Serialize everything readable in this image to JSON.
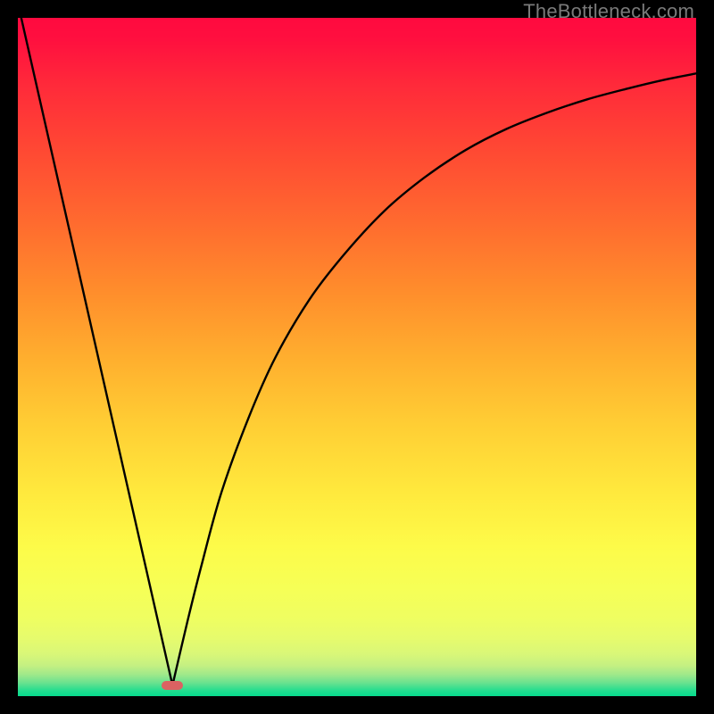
{
  "watermark": "TheBottleneck.com",
  "chart_data": {
    "type": "line",
    "title": "",
    "xlabel": "",
    "ylabel": "",
    "xlim": [
      0,
      100
    ],
    "ylim": [
      0,
      100
    ],
    "grid": false,
    "curve": {
      "comment": "V-shaped bottleneck curve; x in 0..100 across plot width, y is % height from bottom (0=bottom, 100=top)",
      "left_segment": [
        {
          "x": 0.5,
          "y": 100
        },
        {
          "x": 22.8,
          "y": 1.6
        }
      ],
      "right_segment_x": [
        22.8,
        25,
        27,
        30,
        34,
        38,
        43,
        48,
        54,
        60,
        66,
        72,
        78,
        84,
        90,
        95,
        100
      ],
      "right_segment_y": [
        1.6,
        11,
        19,
        30,
        41,
        50,
        58.5,
        65,
        71.5,
        76.5,
        80.5,
        83.6,
        86.0,
        88.0,
        89.6,
        90.8,
        91.8
      ]
    },
    "marker": {
      "shape": "rounded-rect",
      "x": 22.8,
      "y": 1.6,
      "w_pct": 3.2,
      "h_pct": 1.3,
      "color": "#db6262"
    },
    "background_bands": [
      {
        "stop": 0.0,
        "color": "#ff0a3f"
      },
      {
        "stop": 0.03,
        "color": "#ff0f3f"
      },
      {
        "stop": 0.1,
        "color": "#ff2a3a"
      },
      {
        "stop": 0.2,
        "color": "#ff4a33"
      },
      {
        "stop": 0.3,
        "color": "#ff6a2f"
      },
      {
        "stop": 0.4,
        "color": "#ff8c2c"
      },
      {
        "stop": 0.5,
        "color": "#ffae2e"
      },
      {
        "stop": 0.6,
        "color": "#ffce34"
      },
      {
        "stop": 0.7,
        "color": "#ffe93d"
      },
      {
        "stop": 0.78,
        "color": "#fdfb49"
      },
      {
        "stop": 0.84,
        "color": "#f6ff56"
      },
      {
        "stop": 0.885,
        "color": "#effe61"
      },
      {
        "stop": 0.915,
        "color": "#e6fb6d"
      },
      {
        "stop": 0.938,
        "color": "#d9f778"
      },
      {
        "stop": 0.955,
        "color": "#c4f082"
      },
      {
        "stop": 0.968,
        "color": "#a0e98a"
      },
      {
        "stop": 0.98,
        "color": "#6be28f"
      },
      {
        "stop": 0.992,
        "color": "#22dd8f"
      },
      {
        "stop": 1.0,
        "color": "#06db8d"
      }
    ]
  }
}
